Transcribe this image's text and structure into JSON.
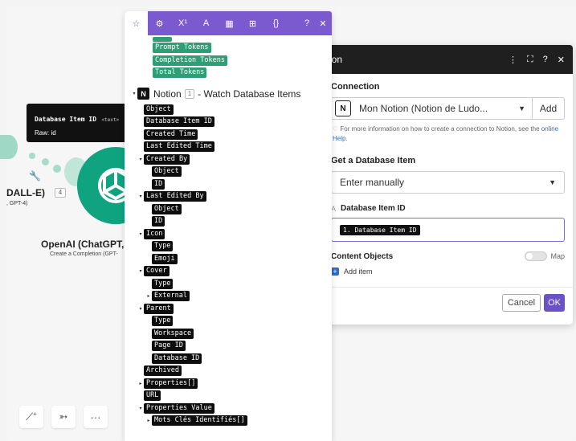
{
  "left_module": {
    "dalle_label": "DALL-E)",
    "dalle_sub": ", GPT-4)",
    "dalle_num": "4",
    "openai_title": "OpenAI (ChatGPT, W",
    "openai_sub": "Create a Completion (GPT-"
  },
  "tooltip": {
    "title": "Database Item ID",
    "type": "<text>",
    "raw": "Raw: id"
  },
  "map_panel": {
    "tabs": [
      "star-icon",
      "gear-icon",
      "superscript-icon",
      "text-icon",
      "calendar-icon",
      "table-icon",
      "braces-icon"
    ],
    "tab_glyphs": [
      "☆",
      "⚙",
      "X¹",
      "A",
      "▦",
      "⊞",
      "{}"
    ],
    "help": "?",
    "close": "✕",
    "green_tokens": [
      "Prompt Tokens",
      "Completion Tokens",
      "Total Tokens"
    ],
    "notion": {
      "logo": "N",
      "name": "Notion",
      "num": "1",
      "rest": "- Watch Database Items"
    },
    "tree": [
      {
        "label": "Object",
        "depth": 0,
        "arrow": ""
      },
      {
        "label": "Database Item ID",
        "depth": 0,
        "arrow": ""
      },
      {
        "label": "Created Time",
        "depth": 0,
        "arrow": ""
      },
      {
        "label": "Last Edited Time",
        "depth": 0,
        "arrow": ""
      },
      {
        "label": "Created By",
        "depth": 0,
        "arrow": "▾"
      },
      {
        "label": "Object",
        "depth": 1,
        "arrow": ""
      },
      {
        "label": "ID",
        "depth": 1,
        "arrow": ""
      },
      {
        "label": "Last Edited By",
        "depth": 0,
        "arrow": "▾"
      },
      {
        "label": "Object",
        "depth": 1,
        "arrow": ""
      },
      {
        "label": "ID",
        "depth": 1,
        "arrow": ""
      },
      {
        "label": "Icon",
        "depth": 0,
        "arrow": "▾"
      },
      {
        "label": "Type",
        "depth": 1,
        "arrow": ""
      },
      {
        "label": "Emoji",
        "depth": 1,
        "arrow": ""
      },
      {
        "label": "Cover",
        "depth": 0,
        "arrow": "▾"
      },
      {
        "label": "Type",
        "depth": 1,
        "arrow": ""
      },
      {
        "label": "External",
        "depth": 1,
        "arrow": "▸"
      },
      {
        "label": "Parent",
        "depth": 0,
        "arrow": "▾"
      },
      {
        "label": "Type",
        "depth": 1,
        "arrow": ""
      },
      {
        "label": "Workspace",
        "depth": 1,
        "arrow": ""
      },
      {
        "label": "Page ID",
        "depth": 1,
        "arrow": ""
      },
      {
        "label": "Database ID",
        "depth": 1,
        "arrow": ""
      },
      {
        "label": "Archived",
        "depth": 0,
        "arrow": ""
      },
      {
        "label": "Properties[]",
        "depth": 0,
        "arrow": "▸"
      },
      {
        "label": "URL",
        "depth": 0,
        "arrow": ""
      },
      {
        "label": "Properties Value",
        "depth": 0,
        "arrow": "▾"
      },
      {
        "label": "Mots Clés Identifiés[]",
        "depth": 1,
        "arrow": "▸"
      }
    ]
  },
  "module_panel": {
    "title": "ion",
    "header_icons": [
      "⋮",
      "⛶",
      "?",
      "✕"
    ],
    "connection_label": "Connection",
    "connection_logo": "N",
    "connection_value": "Mon Notion (Notion de Ludo...",
    "add_label": "Add",
    "help_prefix": "For more information on how to create a connection to Notion, see the ",
    "help_link": "online Help",
    "help_suffix": ".",
    "get_item_label": "Get a Database Item",
    "get_item_value": "Enter manually",
    "field_type": "A",
    "field_label": "Database Item ID",
    "field_value": "1. Database Item ID",
    "content_objects_label": "Content Objects",
    "map_label": "Map",
    "add_item_label": "Add item",
    "cancel_label": "Cancel",
    "ok_label": "OK"
  },
  "bottom_tools": [
    {
      "name": "magic-wand-icon",
      "glyph": "✨"
    },
    {
      "name": "plane-icon",
      "glyph": "✈"
    },
    {
      "name": "more-icon",
      "glyph": "⋯"
    }
  ],
  "colors": {
    "accent_purple": "#7b5ad0",
    "token_green": "#2e9e74",
    "openai_green": "#0fa37f",
    "ok_button": "#6b52c7"
  }
}
